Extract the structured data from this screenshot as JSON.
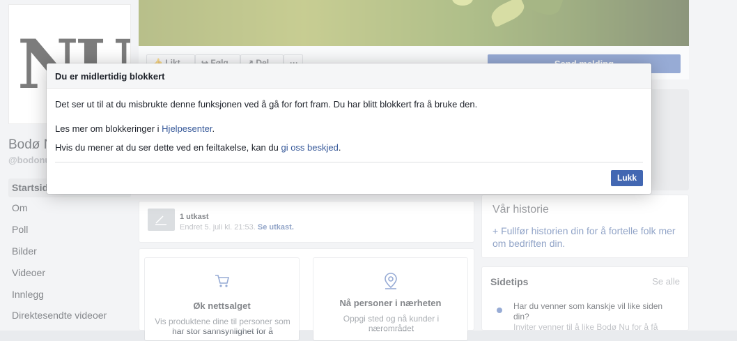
{
  "page": {
    "name": "Bodø Nu",
    "handle": "@bodonu",
    "logo_text": "NU"
  },
  "sidebar": {
    "active": "Startside",
    "items": [
      {
        "label": "Om"
      },
      {
        "label": "Poll"
      },
      {
        "label": "Bilder"
      },
      {
        "label": "Videoer"
      },
      {
        "label": "Innlegg"
      },
      {
        "label": "Direktesendte videoer"
      }
    ]
  },
  "actionbar": {
    "like": "Likt",
    "follow": "Følg",
    "share": "Del",
    "more": "···",
    "send_message": "Send melding"
  },
  "draft": {
    "title": "1 utkast",
    "meta": "Endret 5. juli kl. 21:53.",
    "link": "Se utkast."
  },
  "story": {
    "title": "Vår historie",
    "link": "+ Fullfør historien din for å fortelle folk mer om bedriften din."
  },
  "promos": [
    {
      "icon": "cart-icon",
      "title": "Øk nettsalget",
      "desc": "Vis produktene dine til personer som har stor sannsynlighet for å"
    },
    {
      "icon": "location-pin-icon",
      "title": "Nå personer i nærheten",
      "desc": "Oppgi sted og nå kunder i nærområdet"
    }
  ],
  "tips": {
    "title": "Sidetips",
    "see_all": "Se alle",
    "question": "Har du venner som kanskje vil like siden din?",
    "sub": "Inviter venner til å like Bodø Nu for å få"
  },
  "dialog": {
    "title": "Du er midlertidig blokkert",
    "message": "Det ser ut til at du misbrukte denne funksjonen ved å gå for fort fram. Du har blitt blokkert fra å bruke den.",
    "learn_prefix": "Les mer om blokkeringer i ",
    "learn_link": "Hjelpesenter",
    "learn_suffix": ".",
    "mistake_prefix": "Hvis du mener at du ser dette ved en feiltakelse, kan du ",
    "mistake_link": "gi oss beskjed",
    "mistake_suffix": ".",
    "close_label": "Lukk"
  },
  "colors": {
    "brand_blue": "#4267b2",
    "link": "#365899",
    "background": "#e9ebee"
  }
}
